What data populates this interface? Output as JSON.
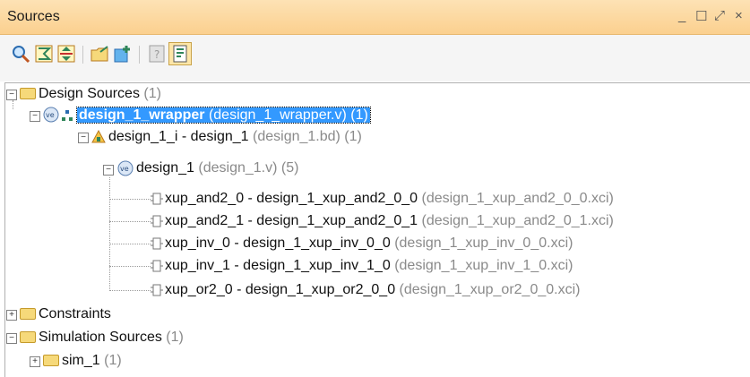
{
  "panel": {
    "title": "Sources",
    "window_controls": [
      "_",
      "☐",
      "⤢",
      "×"
    ]
  },
  "toolbar": {
    "buttons": [
      {
        "icon": "search-icon"
      },
      {
        "icon": "collapse-all-icon"
      },
      {
        "icon": "expand-all-icon"
      },
      {
        "icon": "add-sources-icon"
      },
      {
        "icon": "hierarchy-update-icon"
      },
      {
        "icon": "properties-icon"
      },
      {
        "icon": "show-hierarchy-icon"
      }
    ]
  },
  "tree": {
    "design_sources": {
      "label": "Design Sources",
      "meta": "(1)"
    },
    "wrapper": {
      "label": "design_1_wrapper",
      "meta": "(design_1_wrapper.v) (1)"
    },
    "design_1_i": {
      "label": "design_1_i - design_1",
      "meta": "(design_1.bd) (1)"
    },
    "design_1": {
      "label": "design_1",
      "meta": "(design_1.v) (5)"
    },
    "ips": [
      {
        "label": "xup_and2_0 - design_1_xup_and2_0_0",
        "meta": "(design_1_xup_and2_0_0.xci)"
      },
      {
        "label": "xup_and2_1 - design_1_xup_and2_0_1",
        "meta": "(design_1_xup_and2_0_1.xci)"
      },
      {
        "label": "xup_inv_0 - design_1_xup_inv_0_0",
        "meta": "(design_1_xup_inv_0_0.xci)"
      },
      {
        "label": "xup_inv_1 - design_1_xup_inv_1_0",
        "meta": "(design_1_xup_inv_1_0.xci)"
      },
      {
        "label": "xup_or2_0 - design_1_xup_or2_0_0",
        "meta": "(design_1_xup_or2_0_0.xci)"
      }
    ],
    "constraints": {
      "label": "Constraints"
    },
    "simulation_sources": {
      "label": "Simulation Sources",
      "meta": "(1)"
    },
    "sim_1": {
      "label": "sim_1",
      "meta": "(1)"
    }
  }
}
